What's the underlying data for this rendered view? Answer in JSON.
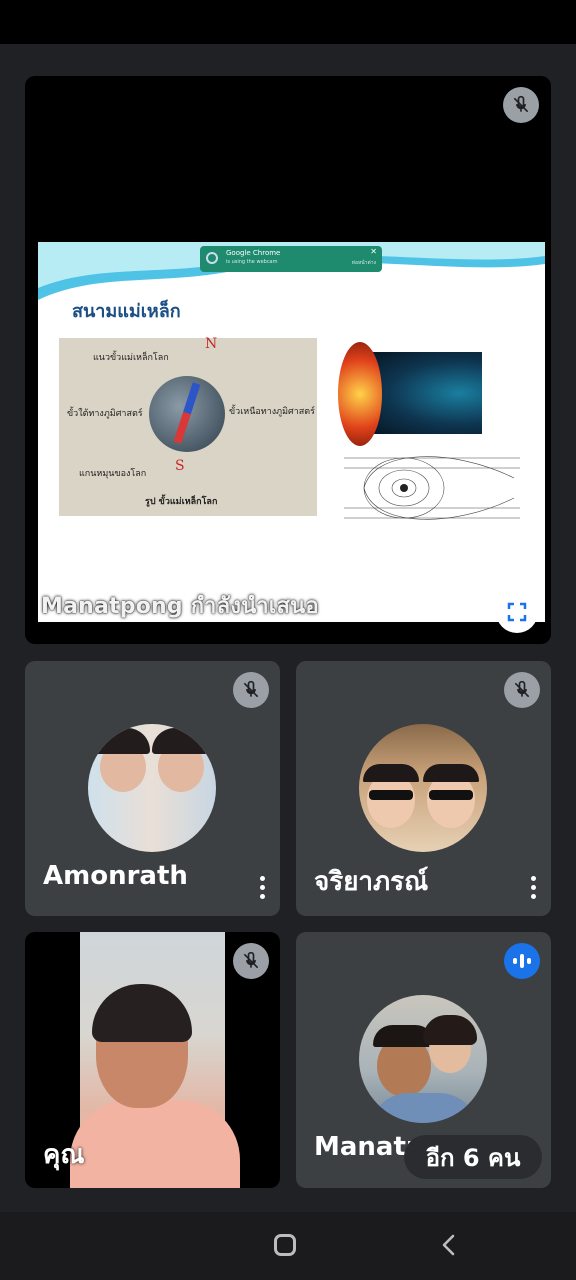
{
  "presentation": {
    "presenter_label": "Manatpong กำลังนำเสนอ",
    "slide": {
      "title": "สนามแม่เหล็ก",
      "chrome_popup": {
        "title": "Google Chrome",
        "subtitle": "is using the webcam",
        "right_text": "ห่อหน้าต่าง"
      },
      "photo_labels": {
        "top": "แนวขั้วแม่เหล็กโลก",
        "left": "ขั้วใต้ทางภูมิศาสตร์",
        "right": "ขั้วเหนือทางภูมิศาสตร์",
        "axis": "แกนหมุนของโลก",
        "caption": "รูป ขั้วแม่เหล็กโลก",
        "n_mark": "N",
        "s_mark": "S"
      }
    },
    "mic_muted": true,
    "fullscreen_icon": "fullscreen-icon"
  },
  "participants": [
    {
      "name": "Amonrath",
      "muted": true
    },
    {
      "name": "จริยาภรณ์",
      "muted": true
    },
    {
      "name": "คุณ",
      "muted": true
    },
    {
      "name": "Manatpong",
      "speaking": true
    }
  ],
  "others_label": "อีก 6 คน",
  "colors": {
    "tile": "#3c4043",
    "background": "#202124",
    "speaking": "#1a73e8"
  }
}
